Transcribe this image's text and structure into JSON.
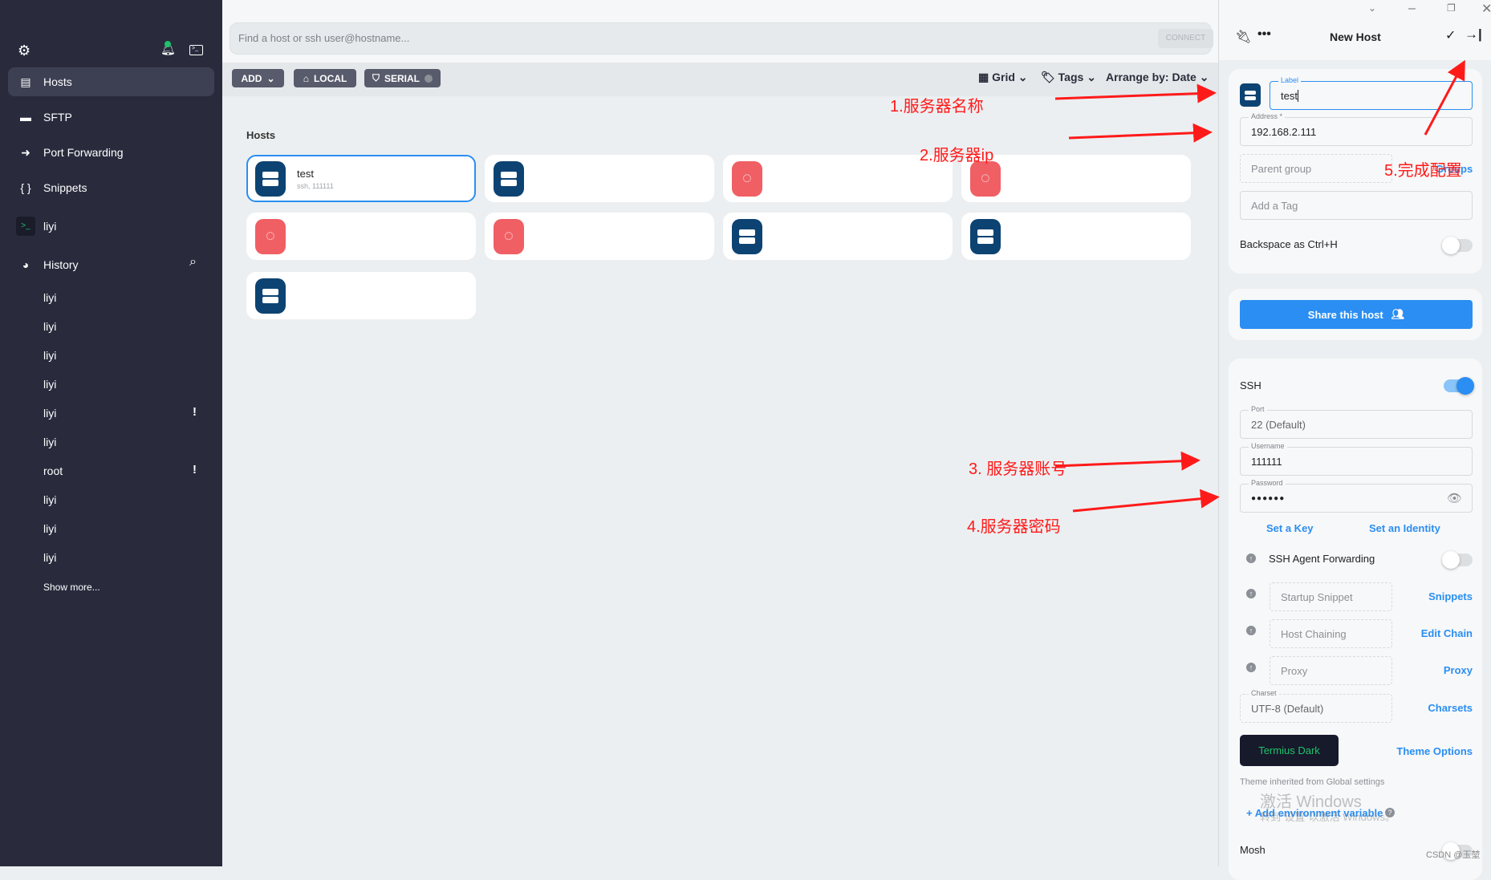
{
  "sidebar": {
    "nav": [
      {
        "label": "Hosts",
        "icon": "hosts-icon"
      },
      {
        "label": "SFTP",
        "icon": "folder-icon"
      },
      {
        "label": "Port Forwarding",
        "icon": "port-forward-icon"
      },
      {
        "label": "Snippets",
        "icon": "braces-icon"
      }
    ],
    "terminal_session": "liyi",
    "history_label": "History",
    "history": [
      {
        "name": "liyi",
        "warn": ""
      },
      {
        "name": "liyi",
        "warn": ""
      },
      {
        "name": "liyi",
        "warn": ""
      },
      {
        "name": "liyi",
        "warn": ""
      },
      {
        "name": "liyi",
        "warn": "!"
      },
      {
        "name": "liyi",
        "warn": ""
      },
      {
        "name": "root",
        "warn": "!"
      },
      {
        "name": "liyi",
        "warn": ""
      },
      {
        "name": "liyi",
        "warn": ""
      },
      {
        "name": "liyi",
        "warn": ""
      }
    ],
    "show_more": "Show more..."
  },
  "search": {
    "placeholder": "Find a host or ssh user@hostname...",
    "connect": "CONNECT"
  },
  "toolbar": {
    "add": "ADD",
    "local": "LOCAL",
    "serial": "SERIAL",
    "grid": "Grid",
    "tags": "Tags",
    "arrange": "Arrange by: Date"
  },
  "hosts": {
    "heading": "Hosts",
    "items": [
      {
        "name": "test",
        "sub": "ssh, 111111",
        "icon": "server"
      },
      {
        "name": "",
        "sub": "",
        "icon": "server"
      },
      {
        "name": "",
        "sub": "",
        "icon": "ubuntu"
      },
      {
        "name": "",
        "sub": "",
        "icon": "ubuntu"
      },
      {
        "name": "",
        "sub": "",
        "icon": "ubuntu"
      },
      {
        "name": "",
        "sub": "",
        "icon": "ubuntu"
      },
      {
        "name": "",
        "sub": "",
        "icon": "server"
      },
      {
        "name": "",
        "sub": "",
        "icon": "server"
      },
      {
        "name": "",
        "sub": "",
        "icon": "server"
      }
    ]
  },
  "panel": {
    "title": "New Host",
    "label": {
      "label": "Label",
      "value": "test"
    },
    "address": {
      "label": "Address *",
      "value": "192.168.2.111"
    },
    "parent_group": "Parent group",
    "groups_link": "Groups",
    "tag": "Add a Tag",
    "backspace": "Backspace as Ctrl+H",
    "share": "Share this host",
    "ssh": "SSH",
    "port": {
      "label": "Port",
      "value": "22 (Default)"
    },
    "username": {
      "label": "Username",
      "value": "111111"
    },
    "password": {
      "label": "Password",
      "value": "●●●●●●"
    },
    "set_key": "Set a Key",
    "set_identity": "Set an Identity",
    "agent_forwarding": "SSH Agent Forwarding",
    "startup_snippet": "Startup Snippet",
    "snippets_link": "Snippets",
    "host_chaining": "Host Chaining",
    "edit_chain": "Edit Chain",
    "proxy": "Proxy",
    "proxy_link": "Proxy",
    "charset": {
      "label": "Charset",
      "value": "UTF-8 (Default)"
    },
    "charsets_link": "Charsets",
    "theme": "Termius Dark",
    "theme_options": "Theme Options",
    "theme_note": "Theme inherited from Global settings",
    "add_env": "+ Add environment variable",
    "mosh": "Mosh",
    "toggles": {
      "backspace": false,
      "ssh": true,
      "agent_forwarding": false
    }
  },
  "annotations": {
    "a1": "1.服务器名称",
    "a2": "2.服务器ip",
    "a3": "3. 服务器账号",
    "a4": "4.服务器密码",
    "a5": "5.完成配置",
    "color": "#ff1a1a"
  },
  "watermarks": {
    "windows1": "激活 Windows",
    "windows2": "转到“设置”以激活 Windows。",
    "csdn": "CSDN @玉堃"
  },
  "colors": {
    "sidebar": "#292b3d",
    "accent": "#2a8ef2",
    "server_icon": "#0d4372",
    "ubuntu_icon": "#ef5f64"
  }
}
